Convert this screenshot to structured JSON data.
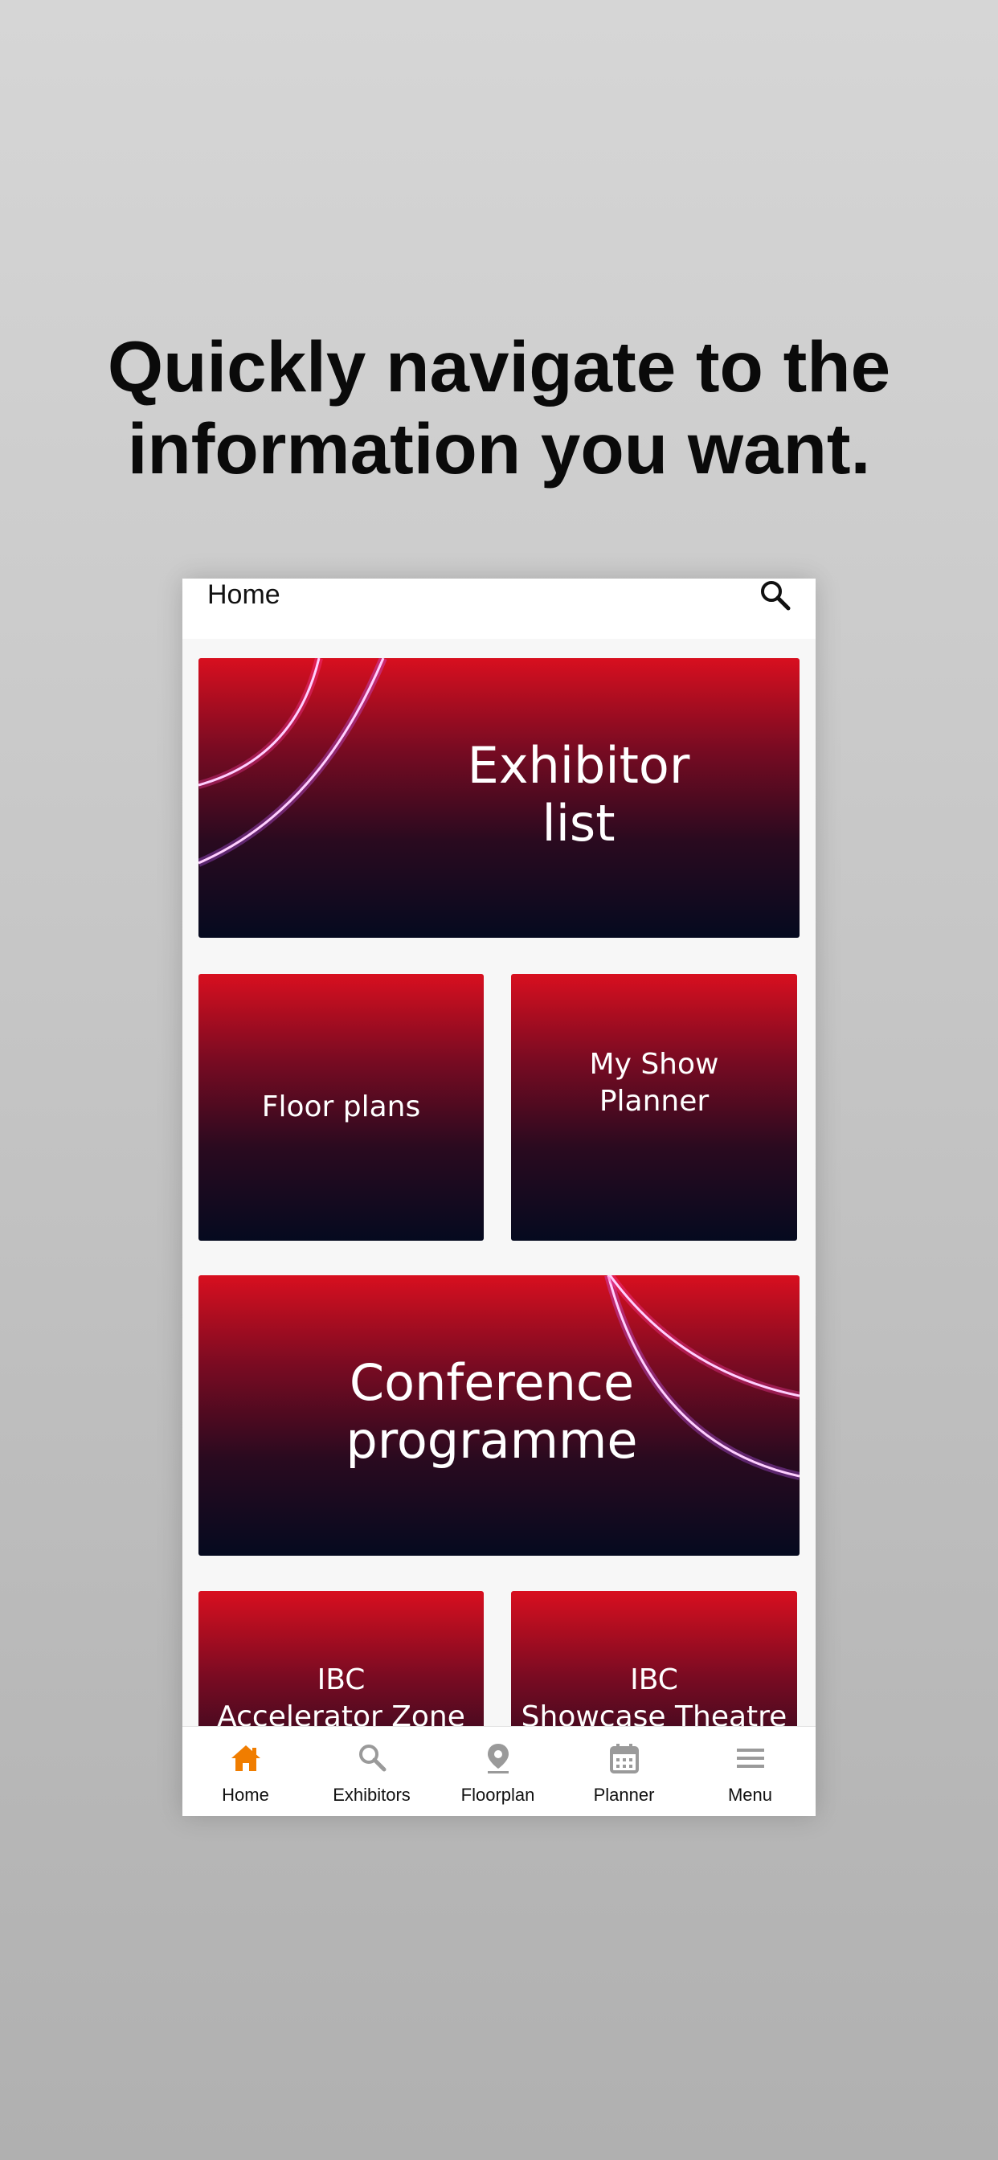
{
  "headline": {
    "line1": "Quickly navigate to the",
    "line2": "information you want."
  },
  "header": {
    "title": "Home",
    "search_icon": "search-icon"
  },
  "tiles": {
    "exhibitor_list": {
      "line1": "Exhibitor",
      "line2": "list"
    },
    "floor_plans": {
      "line1": "Floor plans"
    },
    "my_show_planner": {
      "line1": "My Show",
      "line2": "Planner"
    },
    "conference_programme": {
      "line1": "Conference",
      "line2": "programme"
    },
    "accelerator_zone": {
      "line1": "IBC",
      "line2": "Accelerator Zone"
    },
    "showcase_theatre": {
      "line1": "IBC",
      "line2": "Showcase Theatre"
    }
  },
  "tabbar": {
    "active_color": "#f07d00",
    "inactive_color": "#9a9a9a",
    "items": [
      {
        "label": "Home",
        "icon": "home-icon",
        "active": true
      },
      {
        "label": "Exhibitors",
        "icon": "search-icon",
        "active": false
      },
      {
        "label": "Floorplan",
        "icon": "location-pin-icon",
        "active": false
      },
      {
        "label": "Planner",
        "icon": "calendar-icon",
        "active": false
      },
      {
        "label": "Menu",
        "icon": "menu-icon",
        "active": false
      }
    ]
  },
  "colors": {
    "tile_top": "#d80f1f",
    "tile_bottom": "#050a1f"
  }
}
